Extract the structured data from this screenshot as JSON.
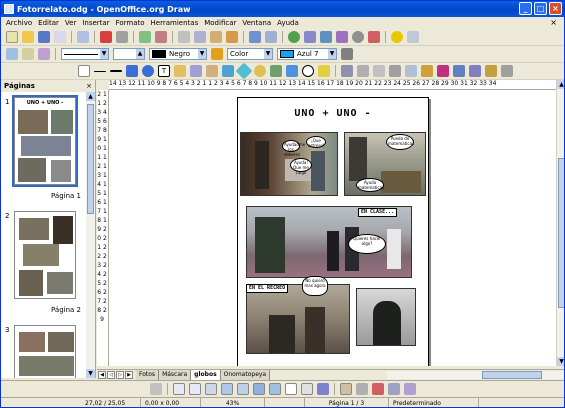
{
  "window": {
    "title": "Fotorrelato.odg - OpenOffice.org Draw",
    "min": "_",
    "max": "□",
    "close": "×"
  },
  "menu": [
    "Archivo",
    "Editar",
    "Ver",
    "Insertar",
    "Formato",
    "Herramientas",
    "Modificar",
    "Ventana",
    "Ayuda"
  ],
  "menu_close": "×",
  "toolbar2": {
    "line_style": "",
    "line_width": "",
    "line_color": "Negro",
    "area_style": "Color",
    "area_color": "Azul 7",
    "line_color_hex": "#000000",
    "area_color_hex": "#1aa0f0"
  },
  "panel": {
    "title": "Páginas",
    "close": "×",
    "pages": [
      {
        "num": "1",
        "label": "Página 1",
        "title": "UNO  +  UNO  -"
      },
      {
        "num": "2",
        "label": "Página 2"
      },
      {
        "num": "3",
        "label": ""
      }
    ]
  },
  "ruler": {
    "h_text": "14 13 12 11 10 9 8 7 6 5 4 3 2 1   1 2 3 4 5 6 7 8 9 10 11 12 13 14 15 16 17 18 19 20 21 22 23 24 25 26 27 28 29 30 31 32 33 34",
    "v_text": "2 1 1 2 3 4 5 6 7 8 9 10 11 12 13 14 15 16 17 18 19 20 21 22 23 24 25 26 27 28 29"
  },
  "slide": {
    "title": "UNO  +  UNO  -",
    "bubbles": [
      "Ayudadme los deberes",
      "¡Que estreso!",
      "Ayuda! Que me caigo",
      "Puedo de matematicas",
      "Ayuda matematicas",
      "Quieres hacer algo?",
      "No quiero mas agora"
    ],
    "captions": [
      "EN CLASE...",
      "EN EL RECREO"
    ]
  },
  "tabs": [
    "Fotos",
    "Máscara",
    "globos",
    "Onomatopeya"
  ],
  "tabs_active": "globos",
  "status": {
    "position": "27,02 / 25,05",
    "size": "0,00 x 0,00",
    "zoom": "43%",
    "page": "Página 1 / 3",
    "layout": "Predeterminado"
  }
}
